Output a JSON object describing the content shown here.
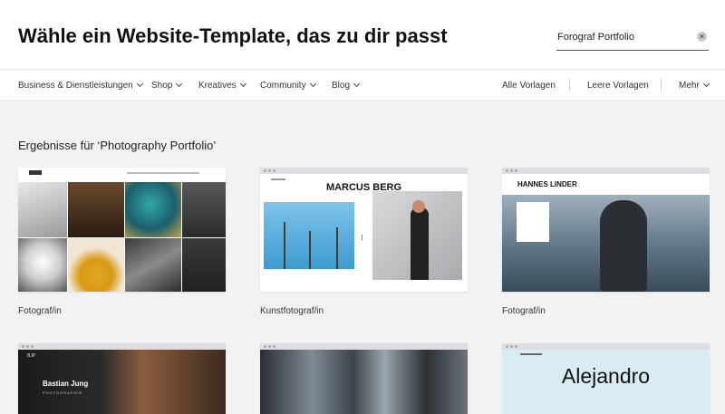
{
  "header": {
    "title": "Wähle ein Website-Template, das zu dir passt",
    "search_value": "Forograf Portfolio",
    "clear_icon": "close-icon"
  },
  "nav": {
    "categories": [
      "Business & Dienstleistungen",
      "Shop",
      "Kreatives",
      "Community",
      "Blog"
    ],
    "links": [
      "Alle Vorlagen",
      "Leere Vorlagen",
      "Mehr"
    ]
  },
  "results_heading": "Ergebnisse für ‘Photography Portfolio’",
  "templates": [
    {
      "label": "Fotograf/in"
    },
    {
      "label": "Kunstfotograf/in",
      "preview_title": "MARCUS BERG"
    },
    {
      "label": "Fotograf/in",
      "preview_title": "HANNES LINDER"
    },
    {
      "preview_title": "Bastian Jung",
      "preview_subtitle": "PHOTOGRAPHIE"
    },
    {},
    {
      "preview_title": "Alejandro"
    }
  ],
  "colors": {
    "page_bg": "#f2f2f2",
    "header_bg": "#ffffff",
    "text": "#222222",
    "marcus_sky": "#4da3d6",
    "hannes_sea": "#6e8596",
    "alejandro_bg": "#d9ecf2"
  }
}
